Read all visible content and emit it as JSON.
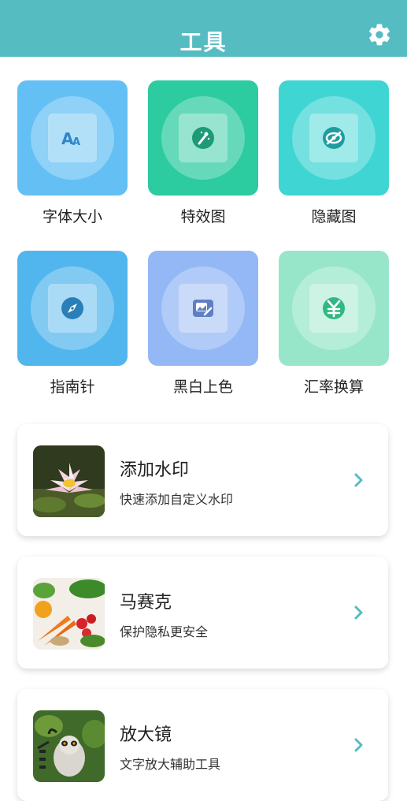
{
  "header": {
    "title": "工具",
    "settings_icon": "gear-icon"
  },
  "tools": [
    {
      "label": "字体大小",
      "icon": "font-size-icon",
      "color": "#64c0f4"
    },
    {
      "label": "特效图",
      "icon": "magic-wand-icon",
      "color": "#2ccba0"
    },
    {
      "label": "隐藏图",
      "icon": "eye-off-icon",
      "color": "#3fd5d3"
    },
    {
      "label": "指南针",
      "icon": "compass-icon",
      "color": "#52b6ee"
    },
    {
      "label": "黑白上色",
      "icon": "image-edit-icon",
      "color": "#94b8f5"
    },
    {
      "label": "汇率换算",
      "icon": "yuan-icon",
      "color": "#98e6ca"
    }
  ],
  "list": [
    {
      "title": "添加水印",
      "subtitle": "快速添加自定义水印",
      "thumb": "lotus-photo"
    },
    {
      "title": "马赛克",
      "subtitle": "保护隐私更安全",
      "thumb": "vegetables-photo"
    },
    {
      "title": "放大镜",
      "subtitle": "文字放大辅助工具",
      "thumb": "lemur-photo"
    }
  ]
}
